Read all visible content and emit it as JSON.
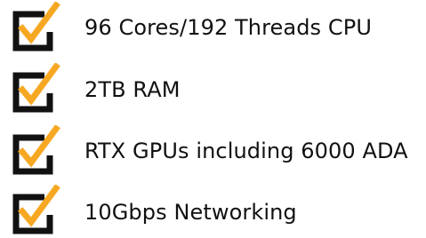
{
  "features": [
    {
      "label": "96 Cores/192 Threads CPU",
      "icon": "checkbox-checked-icon"
    },
    {
      "label": "2TB RAM",
      "icon": "checkbox-checked-icon"
    },
    {
      "label": "RTX GPUs including 6000 ADA",
      "icon": "checkbox-checked-icon"
    },
    {
      "label": "10Gbps Networking",
      "icon": "checkbox-checked-icon"
    }
  ],
  "colors": {
    "box": "#111111",
    "check": "#f7a823",
    "text": "#111111"
  }
}
